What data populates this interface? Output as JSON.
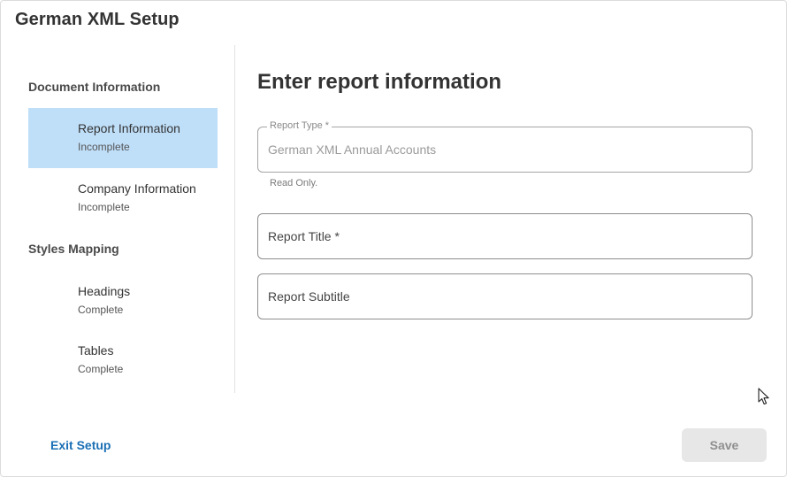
{
  "dialog": {
    "title": "German XML Setup"
  },
  "sidebar": {
    "sections": [
      {
        "heading": "Document Information",
        "items": [
          {
            "label": "Report Information",
            "status": "Incomplete",
            "active": true
          },
          {
            "label": "Company Information",
            "status": "Incomplete",
            "active": false
          }
        ]
      },
      {
        "heading": "Styles Mapping",
        "items": [
          {
            "label": "Headings",
            "status": "Complete",
            "active": false
          },
          {
            "label": "Tables",
            "status": "Complete",
            "active": false
          }
        ]
      }
    ]
  },
  "main": {
    "title": "Enter report information",
    "fields": [
      {
        "label": "Report Type *",
        "value": "German XML Annual Accounts",
        "helper": "Read Only.",
        "readonly": true
      },
      {
        "placeholder": "Report Title *",
        "value": ""
      },
      {
        "placeholder": "Report Subtitle",
        "value": ""
      }
    ]
  },
  "footer": {
    "exit_label": "Exit Setup",
    "save_label": "Save"
  },
  "colors": {
    "active_item_bg": "#bfdef8",
    "link": "#1a6fb5",
    "disabled_button_bg": "#e7e7e7"
  }
}
